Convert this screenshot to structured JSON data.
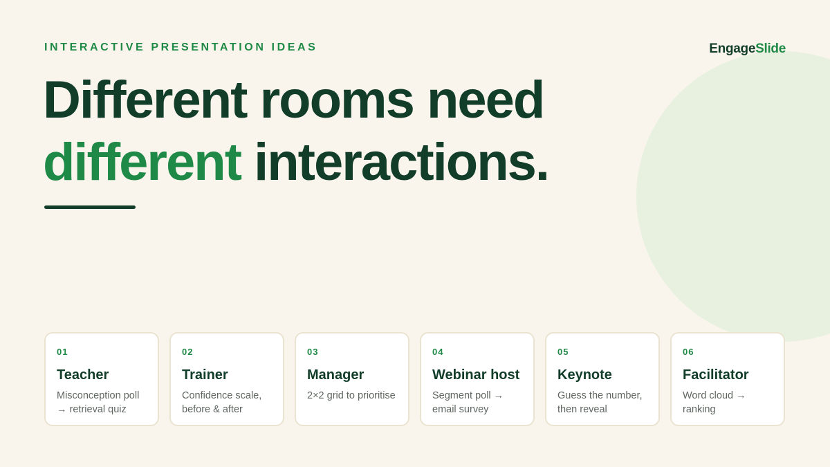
{
  "eyebrow": "INTERACTIVE PRESENTATION IDEAS",
  "brand": {
    "part1": "Engage",
    "part2": "Slide"
  },
  "headline": {
    "line1": "Different rooms need",
    "line2_accent": "different",
    "line2_rest": " interactions."
  },
  "colors": {
    "background": "#f9f5ec",
    "dark_green": "#123d29",
    "accent_green": "#1f8a47",
    "circle": "#e8f1e0",
    "card_border": "#eae3d1"
  },
  "cards": [
    {
      "num": "01",
      "title": "Teacher",
      "desc": "Misconception poll → retrieval quiz"
    },
    {
      "num": "02",
      "title": "Trainer",
      "desc": "Confidence scale, before & after"
    },
    {
      "num": "03",
      "title": "Manager",
      "desc": "2×2 grid to prioritise"
    },
    {
      "num": "04",
      "title": "Webinar host",
      "desc": "Segment poll → email survey"
    },
    {
      "num": "05",
      "title": "Keynote",
      "desc": "Guess the number, then reveal"
    },
    {
      "num": "06",
      "title": "Facilitator",
      "desc": "Word cloud → ranking"
    }
  ]
}
